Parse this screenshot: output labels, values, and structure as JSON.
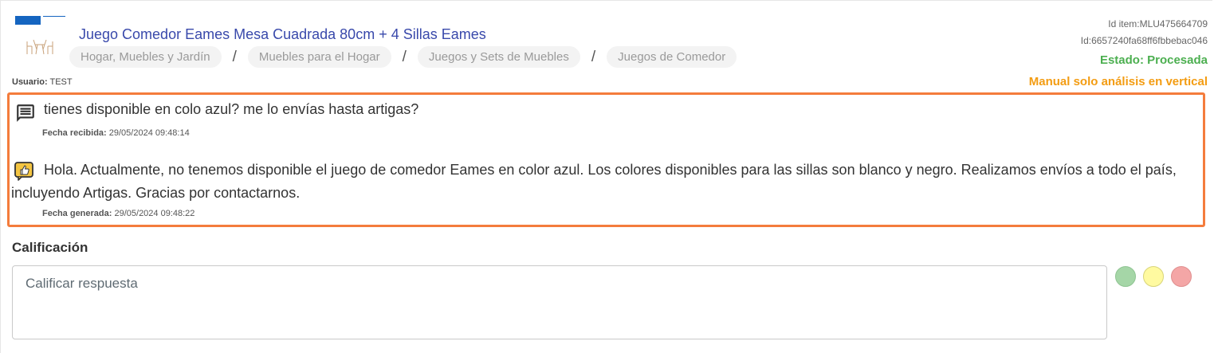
{
  "product": {
    "title": "Juego Comedor Eames Mesa Cuadrada 80cm + 4 Sillas Eames",
    "image_icon": "dining-set-thumbnail",
    "breadcrumb": [
      "Hogar, Muebles y Jardín",
      "Muebles para el Hogar",
      "Juegos y Sets de Muebles",
      "Juegos de Comedor"
    ],
    "separator": "/"
  },
  "meta": {
    "item_id": "Id item:MLU475664709",
    "id": "Id:6657240fa68ff6fbbebac046",
    "estado": "Estado: Procesada",
    "manual": "Manual solo análisis en vertical",
    "estado_color": "#4caf50",
    "manual_color": "#f39c12"
  },
  "usuario": {
    "label": "Usuario:",
    "value": "TEST"
  },
  "conversation": {
    "question": {
      "icon": "message-icon",
      "text": "tienes disponible en colo azul? me lo envías hasta artigas?",
      "date_label": "Fecha recibida:",
      "date_value": "29/05/2024 09:48:14"
    },
    "answer": {
      "icon": "thumbs-up-bubble-icon",
      "text": "Hola. Actualmente, no tenemos disponible el juego de comedor Eames en color azul. Los colores disponibles para las sillas son blanco y negro. Realizamos envíos a todo el país, incluyendo Artigas. Gracias por contactarnos.",
      "date_label": "Fecha generada:",
      "date_value": "29/05/2024 09:48:22"
    },
    "border_color": "#f47c3c"
  },
  "calificacion": {
    "label": "Calificación",
    "placeholder": "Calificar respuesta",
    "value": "",
    "ratings": [
      {
        "name": "green",
        "color": "#a5d6a7"
      },
      {
        "name": "yellow",
        "color": "#fffaa0"
      },
      {
        "name": "red",
        "color": "#f4a6a6"
      }
    ]
  }
}
